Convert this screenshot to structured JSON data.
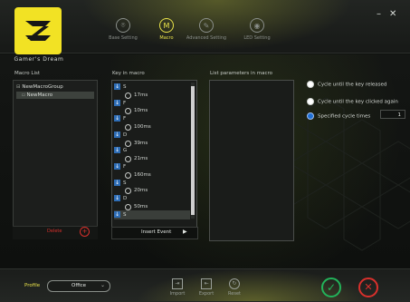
{
  "brand": {
    "caption": "Gamer's Dream"
  },
  "nav": [
    {
      "label": "Base Setting",
      "icon": "mouse-icon",
      "active": false
    },
    {
      "label": "Macro",
      "icon": "macro-icon",
      "active": true
    },
    {
      "label": "Advanced Setting",
      "icon": "wrench-icon",
      "active": false
    },
    {
      "label": "LED Setting",
      "icon": "led-icon",
      "active": false
    }
  ],
  "window": {
    "minimize": "–",
    "close": "✕"
  },
  "macro_list": {
    "title": "Macro List",
    "group": "NewMacroGroup",
    "item": "NewMacro",
    "delete_label": "Delete",
    "add_label": "+"
  },
  "key_in_macro": {
    "title": "Key in macro",
    "rows": [
      {
        "kind": "key",
        "text": "S"
      },
      {
        "kind": "delay",
        "text": "17ms"
      },
      {
        "kind": "key",
        "text": "F"
      },
      {
        "kind": "delay",
        "text": "10ms"
      },
      {
        "kind": "key",
        "text": "F"
      },
      {
        "kind": "delay",
        "text": "100ms"
      },
      {
        "kind": "key",
        "text": "D"
      },
      {
        "kind": "delay",
        "text": "39ms"
      },
      {
        "kind": "key",
        "text": "G"
      },
      {
        "kind": "delay",
        "text": "21ms"
      },
      {
        "kind": "key",
        "text": "F"
      },
      {
        "kind": "delay",
        "text": "160ms"
      },
      {
        "kind": "key",
        "text": "S"
      },
      {
        "kind": "delay",
        "text": "20ms"
      },
      {
        "kind": "key",
        "text": "D"
      },
      {
        "kind": "delay",
        "text": "50ms"
      },
      {
        "kind": "key",
        "text": "S"
      }
    ],
    "insert_event_label": "Insert Event",
    "insert_arrow": "▶"
  },
  "list_parameters": {
    "title": "List parameters in macro"
  },
  "cycle_options": [
    {
      "label": "Cycle until the key released",
      "selected": false
    },
    {
      "label": "Cycle until the key clicked again",
      "selected": false
    },
    {
      "label": "Specified cycle times",
      "selected": true
    }
  ],
  "cycle_times_value": "1",
  "footer": {
    "profile_label": "Profile",
    "profile_value": "Office",
    "import_label": "Import",
    "export_label": "Export",
    "reset_label": "Reset",
    "ok_symbol": "✓",
    "cancel_symbol": "✕"
  },
  "colors": {
    "accent_yellow": "#f2e224",
    "ok_green": "#22b35a",
    "cancel_red": "#d9302c",
    "selection_blue": "#1e6fd6"
  }
}
